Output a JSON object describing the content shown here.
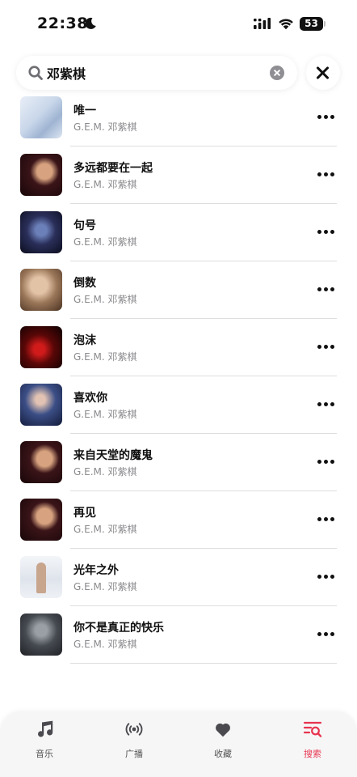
{
  "status_bar": {
    "time": "22:38",
    "battery": "53"
  },
  "search": {
    "query": "邓紫棋"
  },
  "songs": [
    {
      "title": "唯一",
      "artist": "G.E.M. 邓紫棋"
    },
    {
      "title": "多远都要在一起",
      "artist": "G.E.M. 邓紫棋"
    },
    {
      "title": "句号",
      "artist": "G.E.M. 邓紫棋"
    },
    {
      "title": "倒数",
      "artist": "G.E.M. 邓紫棋"
    },
    {
      "title": "泡沫",
      "artist": "G.E.M. 邓紫棋"
    },
    {
      "title": "喜欢你",
      "artist": "G.E.M. 邓紫棋"
    },
    {
      "title": "来自天堂的魔鬼",
      "artist": "G.E.M. 邓紫棋"
    },
    {
      "title": "再见",
      "artist": "G.E.M. 邓紫棋"
    },
    {
      "title": "光年之外",
      "artist": "G.E.M. 邓紫棋"
    },
    {
      "title": "你不是真正的快乐",
      "artist": "G.E.M. 邓紫棋"
    }
  ],
  "tabs": [
    {
      "label": "音乐",
      "icon": "music-note-icon"
    },
    {
      "label": "广播",
      "icon": "radio-broadcast-icon"
    },
    {
      "label": "收藏",
      "icon": "heart-icon"
    },
    {
      "label": "搜索",
      "icon": "search-list-icon",
      "active": true
    }
  ],
  "colors": {
    "accent": "#e8344e",
    "text": "#111111",
    "secondary": "#8a8a8e"
  }
}
